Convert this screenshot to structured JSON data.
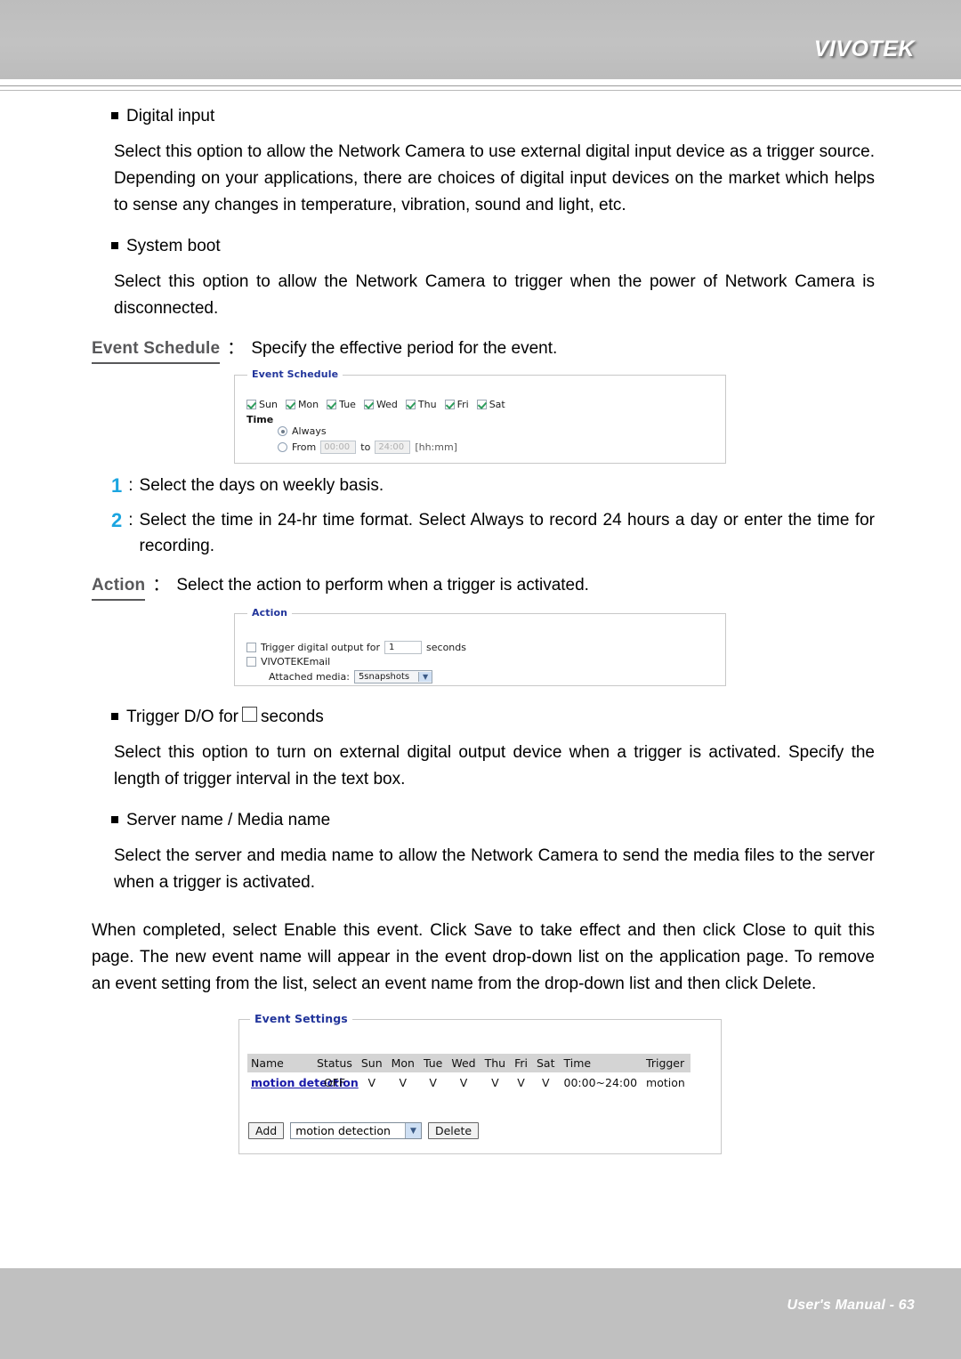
{
  "header": {
    "brand": "VIVOTEK"
  },
  "footer": {
    "text": "User's Manual - 63"
  },
  "content": {
    "digital_input_heading": "Digital input",
    "digital_input_body": "Select this option to allow the Network Camera to use external digital input device as a trigger source. Depending on your applications, there are choices of digital input devices on the market which helps to sense any changes in temperature, vibration, sound and light, etc.",
    "system_boot_heading": "System boot",
    "system_boot_body": "Select this option to allow the Network Camera to trigger when the power of Network Camera is disconnected.",
    "event_schedule_term": "Event Schedule",
    "event_schedule_desc": "Specify the effective period for the event.",
    "colon": "：",
    "steps": [
      {
        "num": "1",
        "text": "Select the days on weekly basis."
      },
      {
        "num": "2",
        "text": "Select the time in 24-hr time format. Select Always to record 24 hours a day or enter the time for recording."
      }
    ],
    "action_term": "Action",
    "action_desc": "Select the action to perform when a trigger is activated.",
    "trigger_do_heading_pre": "Trigger D/O for",
    "trigger_do_heading_post": "seconds",
    "trigger_do_body": "Select this option to turn on external digital output device when a trigger is activated. Specify the length of trigger interval in the text box.",
    "server_media_heading": "Server name / Media name",
    "server_media_body": "Select the server and media name to allow the Network Camera to send the media files to the server when a trigger is activated.",
    "closing_body": "When completed, select Enable this event. Click Save to take effect and then click Close to quit this page. The new event name will appear in the event drop-down list on the application page. To remove an event setting from the list, select an event name from the drop-down list and then click Delete."
  },
  "event_schedule_panel": {
    "legend": "Event Schedule",
    "days": [
      {
        "label": "Sun",
        "checked": true
      },
      {
        "label": "Mon",
        "checked": true
      },
      {
        "label": "Tue",
        "checked": true
      },
      {
        "label": "Wed",
        "checked": true
      },
      {
        "label": "Thu",
        "checked": true
      },
      {
        "label": "Fri",
        "checked": true
      },
      {
        "label": "Sat",
        "checked": true
      }
    ],
    "time_label": "Time",
    "always_label": "Always",
    "always_selected": true,
    "from_label": "From",
    "from_value": "00:00",
    "to_label": "to",
    "to_value": "24:00",
    "format_hint": "[hh:mm]"
  },
  "action_panel": {
    "legend": "Action",
    "trigger_output_pre": "Trigger digital output for",
    "trigger_output_value": "1",
    "trigger_output_post": "seconds",
    "trigger_output_checked": false,
    "email_label": "VIVOTEKEmail",
    "email_checked": false,
    "attached_media_label": "Attached media:",
    "attached_media_value": "5snapshots"
  },
  "event_settings_panel": {
    "legend": "Event Settings",
    "columns": [
      "Name",
      "Status",
      "Sun",
      "Mon",
      "Tue",
      "Wed",
      "Thu",
      "Fri",
      "Sat",
      "Time",
      "Trigger"
    ],
    "rows": [
      {
        "name": "motion detection",
        "status": "OFF",
        "sun": "V",
        "mon": "V",
        "tue": "V",
        "wed": "V",
        "thu": "V",
        "fri": "V",
        "sat": "V",
        "time": "00:00~24:00",
        "trigger": "motion"
      }
    ],
    "add_button": "Add",
    "event_select_value": "motion detection",
    "delete_button": "Delete"
  },
  "colors": {
    "header_gray": "#c0c0c0",
    "step_number_blue": "#1ba5e0",
    "term_gray": "#58585a",
    "panel_legend_blue": "#22359b",
    "link_blue": "#1919a8"
  }
}
